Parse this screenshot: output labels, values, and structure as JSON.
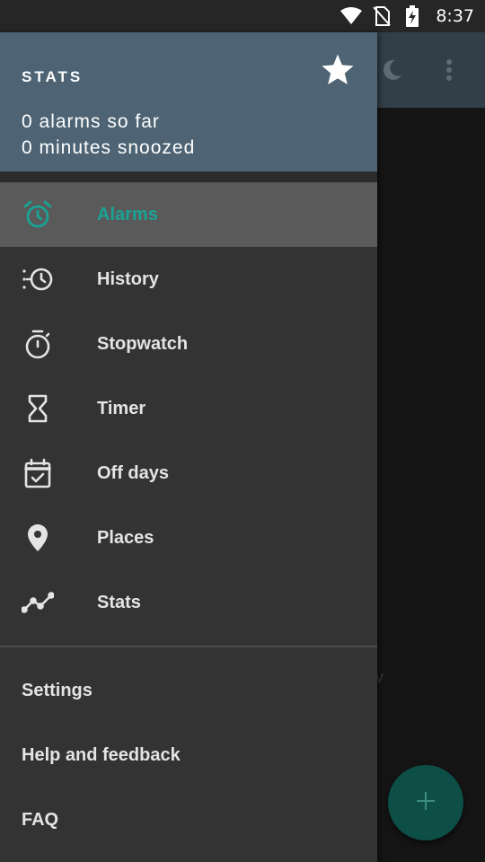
{
  "status_bar": {
    "time": "8:37",
    "icons": [
      "wifi-icon",
      "no-sim-icon",
      "battery-charging-icon"
    ]
  },
  "app": {
    "toolbar_icons": [
      "moon-icon",
      "more-vert-icon"
    ],
    "fab_icon": "plus-icon",
    "ghost_text": "v"
  },
  "drawer": {
    "header": {
      "title": "STATS",
      "line1": "0 alarms so far",
      "line2": "0 minutes snoozed",
      "icon": "star-icon"
    },
    "items": [
      {
        "label": "Alarms",
        "icon": "alarm-clock-icon",
        "active": true
      },
      {
        "label": "History",
        "icon": "history-icon",
        "active": false
      },
      {
        "label": "Stopwatch",
        "icon": "stopwatch-icon",
        "active": false
      },
      {
        "label": "Timer",
        "icon": "hourglass-icon",
        "active": false
      },
      {
        "label": "Off days",
        "icon": "calendar-check-icon",
        "active": false
      },
      {
        "label": "Places",
        "icon": "location-pin-icon",
        "active": false
      },
      {
        "label": "Stats",
        "icon": "trend-line-icon",
        "active": false
      }
    ],
    "secondary_items": [
      {
        "label": "Settings"
      },
      {
        "label": "Help and feedback"
      },
      {
        "label": "FAQ"
      }
    ]
  },
  "colors": {
    "accent": "#1aa394",
    "header_bg": "#4e6474",
    "drawer_bg": "#333333",
    "active_item_bg": "#5a5a5a",
    "fab_bg": "#0d4e47"
  }
}
